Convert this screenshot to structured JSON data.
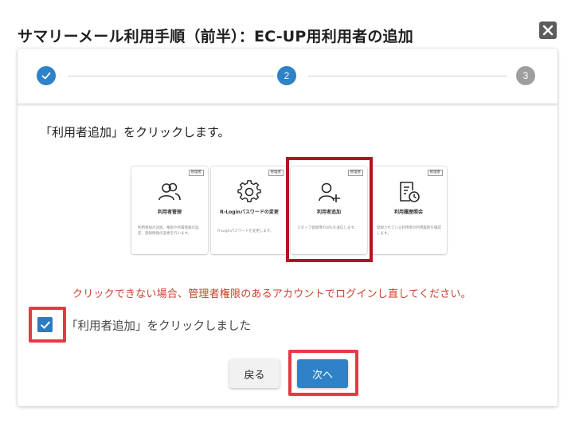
{
  "dialog": {
    "title": "サマリーメール利用手順（前半）：EC-UP用利用者の追加"
  },
  "stepper": {
    "steps": [
      {
        "label": "",
        "state": "completed"
      },
      {
        "label": "2",
        "state": "active"
      },
      {
        "label": "3",
        "state": "inactive"
      }
    ]
  },
  "instruction": "「利用者追加」をクリックします。",
  "tiles": [
    {
      "badge": "管理者",
      "title": "利用者管理",
      "description": "利用者様の追加、権限や所属情報の設定、登録情報の変更を行います。",
      "icon": "users-icon"
    },
    {
      "badge": "管理者",
      "title": "R-Loginパスワードの変更",
      "description": "R-Loginパスワードを変更します。",
      "icon": "gear-icon"
    },
    {
      "badge": "管理者",
      "title": "利用者追加",
      "description": "スタッフ登録用のURLを送信します。",
      "icon": "user-add-icon"
    },
    {
      "badge": "管理者",
      "title": "利用履歴照会",
      "description": "登録されている利用者の利用履歴を確認します。",
      "icon": "history-icon"
    }
  ],
  "warning": "クリックできない場合、管理者権限のあるアカウントでログインし直してください。",
  "confirm_checkbox": {
    "checked": true,
    "label": "「利用者追加」をクリックしました"
  },
  "buttons": {
    "back": "戻る",
    "next": "次へ"
  },
  "colors": {
    "primary": "#2d82c8",
    "step_inactive": "#9e9e9e",
    "highlight_red": "#e63946",
    "tile_highlight": "#b4141e",
    "warning_text": "#c9402b",
    "close_bg": "#5c5c5c"
  }
}
